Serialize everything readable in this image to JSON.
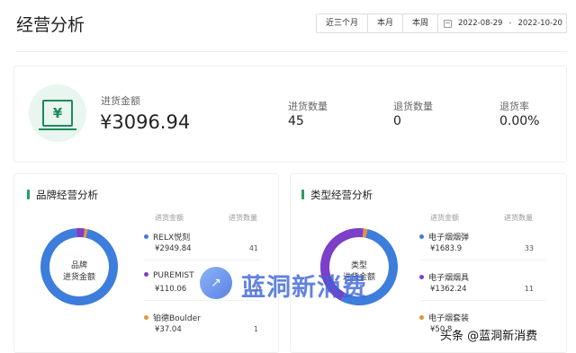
{
  "header": {
    "title": "经营分析",
    "range_buttons": [
      "近三个月",
      "本月",
      "本周"
    ],
    "date_start": "2022-08-29",
    "date_sep": "-",
    "date_end": "2022-10-20"
  },
  "summary": {
    "icon": "yuan-ledger-icon",
    "purchase_amount_label": "进货金额",
    "purchase_amount_value": "¥3096.94",
    "purchase_qty_label": "进货数量",
    "purchase_qty_value": "45",
    "return_qty_label": "退货数量",
    "return_qty_value": "0",
    "return_rate_label": "退货率",
    "return_rate_value": "0.00%"
  },
  "brand_panel": {
    "title": "品牌经营分析",
    "center_line1": "品牌",
    "center_line2": "进货金额",
    "col_amount": "进货金额",
    "col_qty": "进货数量",
    "items": [
      {
        "name": "RELX悦刻",
        "amount": "¥2949.84",
        "qty": "41",
        "color": "#3d7ddb",
        "share": 0.9525
      },
      {
        "name": "PUREMIST",
        "amount": "¥110.06",
        "qty": "3",
        "color": "#7b3fc8",
        "share": 0.0355
      },
      {
        "name": "铂德Boulder",
        "amount": "¥37.04",
        "qty": "1",
        "color": "#e8923a",
        "share": 0.012
      }
    ]
  },
  "type_panel": {
    "title": "类型经营分析",
    "center_line1": "类型",
    "center_line2": "进货金额",
    "col_amount": "进货金额",
    "col_qty": "进货数量",
    "items": [
      {
        "name": "电子烟烟弹",
        "amount": "¥1683.9",
        "qty": "33",
        "color": "#3d7ddb",
        "share": 0.5437
      },
      {
        "name": "电子烟烟具",
        "amount": "¥1362.24",
        "qty": "11",
        "color": "#7b3fc8",
        "share": 0.4399
      },
      {
        "name": "电子烟套装",
        "amount": "¥50.8",
        "qty": "",
        "color": "#e8923a",
        "share": 0.0164
      }
    ]
  },
  "watermark": {
    "logo_glyph": "↗",
    "text": "蓝洞新消费",
    "footer": "头条 @蓝洞新消费"
  }
}
